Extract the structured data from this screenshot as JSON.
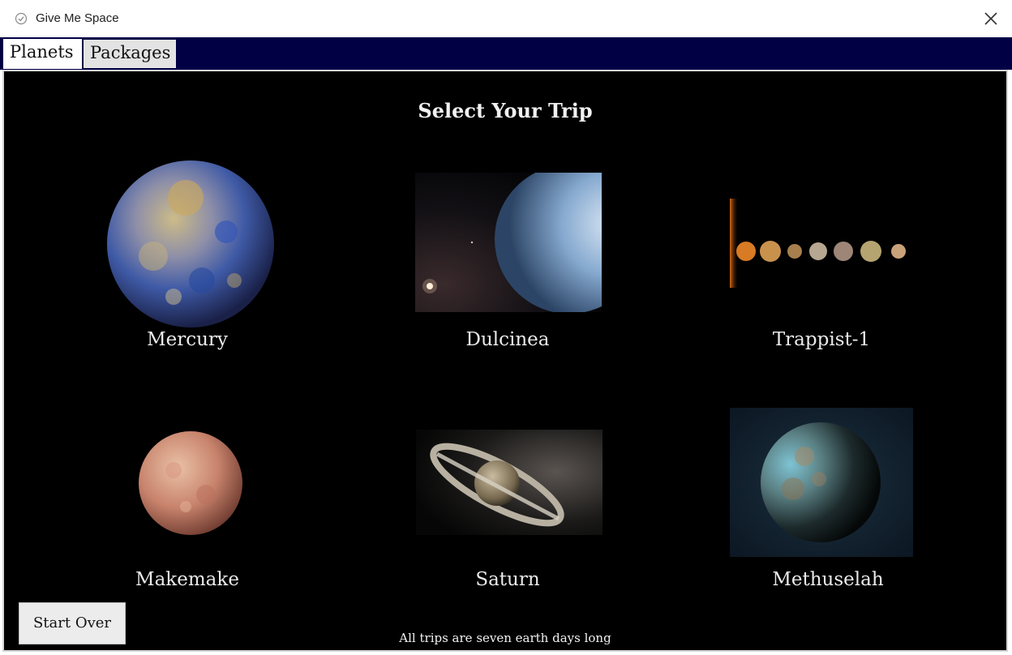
{
  "window": {
    "title": "Give Me Space",
    "app_icon": "check-circle-icon",
    "close_icon": "close-icon"
  },
  "tabs": [
    {
      "label": "Planets",
      "selected": true
    },
    {
      "label": "Packages",
      "selected": false
    }
  ],
  "main": {
    "heading": "Select Your Trip",
    "trips": [
      {
        "name": "Mercury"
      },
      {
        "name": "Dulcinea"
      },
      {
        "name": "Trappist-1"
      },
      {
        "name": "Makemake"
      },
      {
        "name": "Saturn"
      },
      {
        "name": "Methuselah"
      }
    ],
    "start_over_label": "Start Over",
    "footnote": "All trips are seven earth days long"
  },
  "colors": {
    "tab_bar": "#020045",
    "panel_bg": "#000000"
  }
}
